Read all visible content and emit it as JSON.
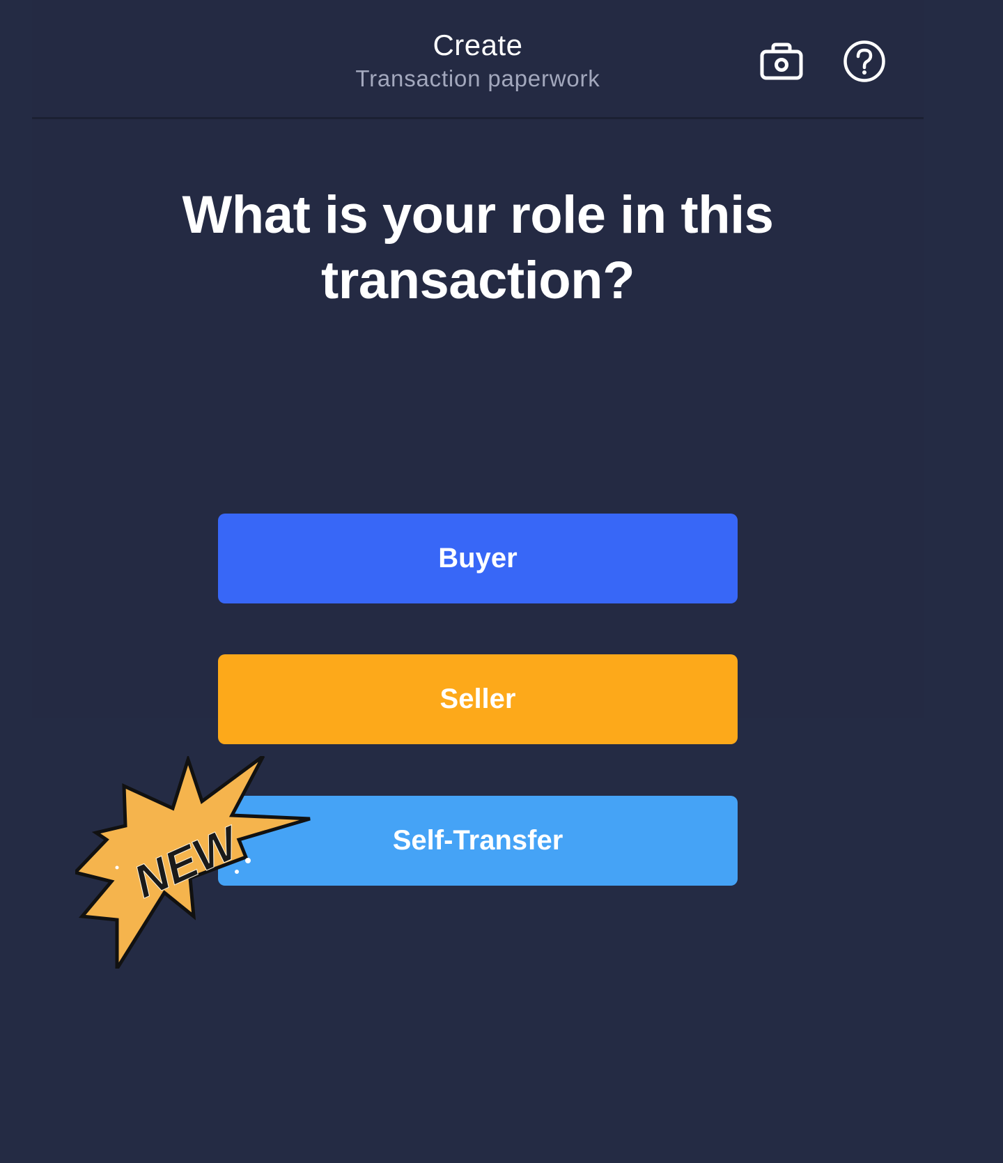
{
  "header": {
    "title": "Create",
    "subtitle": "Transaction paperwork",
    "icons": [
      "camera-icon",
      "help-icon"
    ]
  },
  "question": "What is your role in this transaction?",
  "roles": [
    {
      "label": "Buyer",
      "color": "#3867f7"
    },
    {
      "label": "Seller",
      "color": "#fda91a"
    },
    {
      "label": "Self-Transfer",
      "color": "#45a3f6"
    }
  ],
  "badge": {
    "text": "NEW",
    "color": "#f5b44d"
  },
  "colors": {
    "background": "#242b44",
    "text": "#ffffff",
    "subtitle": "#a3a8bd"
  }
}
